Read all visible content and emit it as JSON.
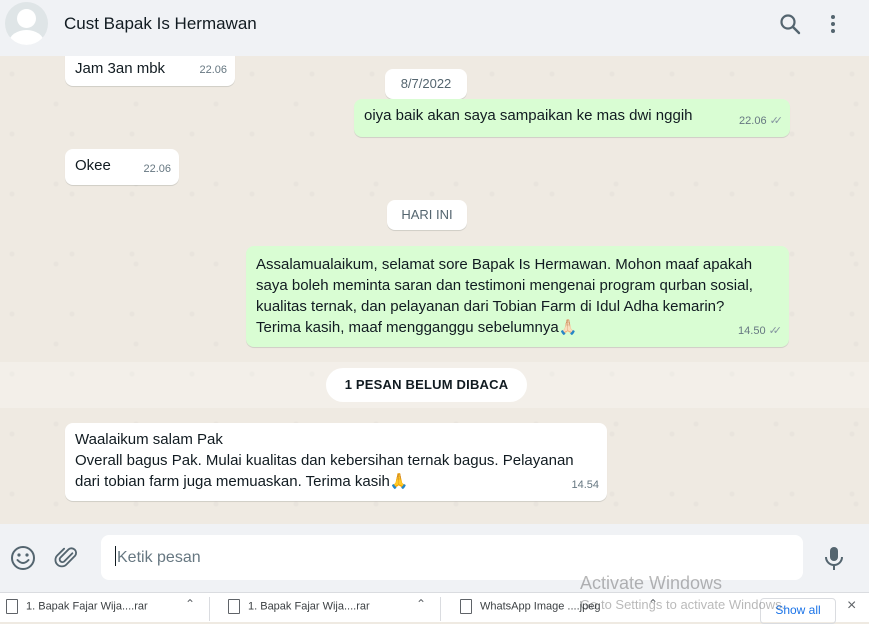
{
  "header": {
    "contact_name": "Cust Bapak Is Hermawan",
    "icons": [
      "avatar-icon",
      "search-icon",
      "menu-dots-icon"
    ]
  },
  "chat": {
    "messages": [
      {
        "direction": "in",
        "text": "Jam 3an mbk",
        "time": "22.06"
      },
      {
        "type": "date",
        "text": "8/7/2022"
      },
      {
        "direction": "out",
        "text": "oiya baik akan saya sampaikan ke mas dwi nggih",
        "time": "22.06",
        "status": "read"
      },
      {
        "direction": "in",
        "text": "Okee",
        "time": "22.06"
      },
      {
        "type": "date",
        "text": "HARI INI"
      },
      {
        "direction": "out",
        "lines": [
          "Assalamualaikum, selamat sore Bapak Is Hermawan. Mohon maaf apakah",
          "saya boleh meminta saran dan testimoni mengenai program qurban sosial,",
          "kualitas ternak, dan pelayanan dari Tobian Farm di Idul Adha kemarin?",
          "Terima kasih, maaf mengganggu sebelumnya🙏🏻"
        ],
        "time": "14.50",
        "status": "read"
      },
      {
        "type": "unread",
        "text": "1 PESAN BELUM DIBACA"
      },
      {
        "direction": "in",
        "lines": [
          "Waalaikum salam Pak",
          "Overall bagus Pak. Mulai kualitas dan kebersihan ternak bagus. Pelayanan",
          "dari tobian farm juga memuaskan. Terima kasih🙏"
        ],
        "time": "14.54"
      }
    ]
  },
  "compose": {
    "placeholder": "Ketik pesan",
    "icons": [
      "emoji-icon",
      "attach-icon",
      "mic-icon"
    ]
  },
  "watermark": {
    "title": "Activate Windows",
    "subtitle": "Go to Settings to activate Windows."
  },
  "downloads": {
    "items": [
      "1. Bapak Fajar Wija....rar",
      "1. Bapak Fajar Wija....rar",
      "WhatsApp Image ....jpeg"
    ],
    "show_all": "Show all",
    "close": "×"
  }
}
